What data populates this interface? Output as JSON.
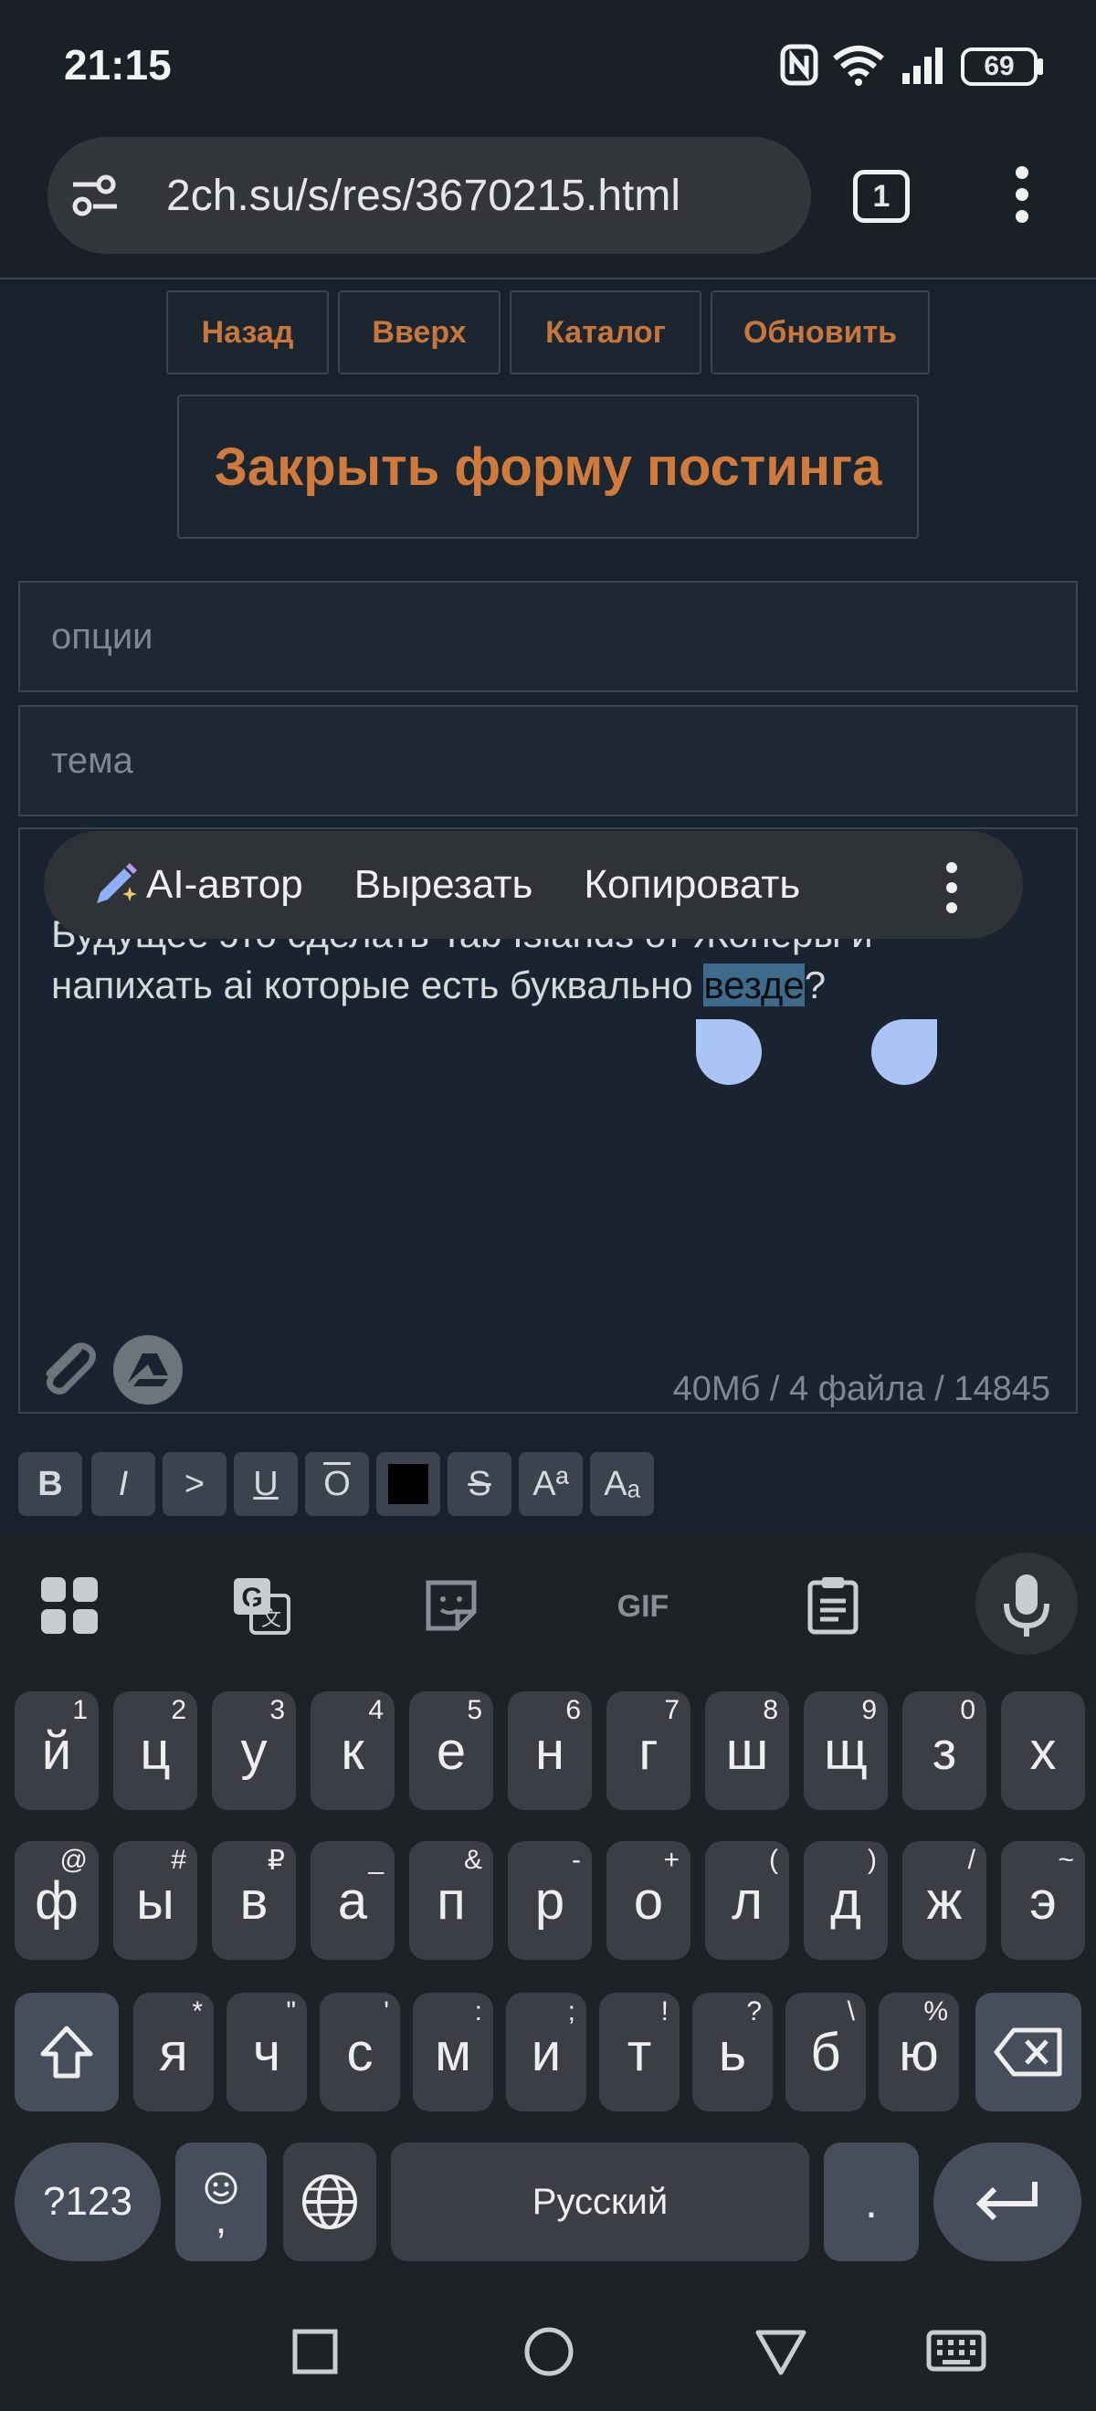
{
  "status_bar": {
    "time": "21:15",
    "battery": "69"
  },
  "browser": {
    "url": "2ch.su/s/res/3670215.html",
    "tab_count": "1"
  },
  "page_nav": {
    "back": "Назад",
    "up": "Вверх",
    "catalog": "Каталог",
    "refresh": "Обновить"
  },
  "close_form_button": "Закрыть форму постинга",
  "form": {
    "options_placeholder": "опции",
    "subject_placeholder": "тема",
    "comment_line1": "Будущее это сделать Tab Islands от Жоперы и",
    "comment_line2_prefix": "напихать ai которые есть буквально ",
    "comment_selected": "везде",
    "comment_line2_suffix": "?",
    "limits": "40Мб / 4 файла / 14845"
  },
  "context_menu": {
    "ai_writer": "AI-автор",
    "cut": "Вырезать",
    "copy": "Копировать"
  },
  "format_toolbar": [
    "B",
    "I",
    ">",
    "U",
    "O",
    "",
    "S",
    "Aª",
    "Aₐ"
  ],
  "keyboard": {
    "language": "Русский",
    "row1": [
      {
        "k": "й",
        "h": "1"
      },
      {
        "k": "ц",
        "h": "2"
      },
      {
        "k": "у",
        "h": "3"
      },
      {
        "k": "к",
        "h": "4"
      },
      {
        "k": "е",
        "h": "5"
      },
      {
        "k": "н",
        "h": "6"
      },
      {
        "k": "г",
        "h": "7"
      },
      {
        "k": "ш",
        "h": "8"
      },
      {
        "k": "щ",
        "h": "9"
      },
      {
        "k": "з",
        "h": "0"
      },
      {
        "k": "х",
        "h": ""
      }
    ],
    "row2": [
      {
        "k": "ф",
        "h": "@"
      },
      {
        "k": "ы",
        "h": "#"
      },
      {
        "k": "в",
        "h": "₽"
      },
      {
        "k": "а",
        "h": "_"
      },
      {
        "k": "п",
        "h": "&"
      },
      {
        "k": "р",
        "h": "-"
      },
      {
        "k": "о",
        "h": "+"
      },
      {
        "k": "л",
        "h": "("
      },
      {
        "k": "д",
        "h": ")"
      },
      {
        "k": "ж",
        "h": "/"
      },
      {
        "k": "э",
        "h": "~"
      }
    ],
    "row3": [
      {
        "k": "я",
        "h": "*"
      },
      {
        "k": "ч",
        "h": "\""
      },
      {
        "k": "с",
        "h": "'"
      },
      {
        "k": "м",
        "h": ":"
      },
      {
        "k": "и",
        "h": ";"
      },
      {
        "k": "т",
        "h": "!"
      },
      {
        "k": "ь",
        "h": "?"
      },
      {
        "k": "б",
        "h": "\\"
      },
      {
        "k": "ю",
        "h": "%"
      }
    ],
    "symbols_key": "?123",
    "emoji_comma_key": ",",
    "period_key": "."
  }
}
